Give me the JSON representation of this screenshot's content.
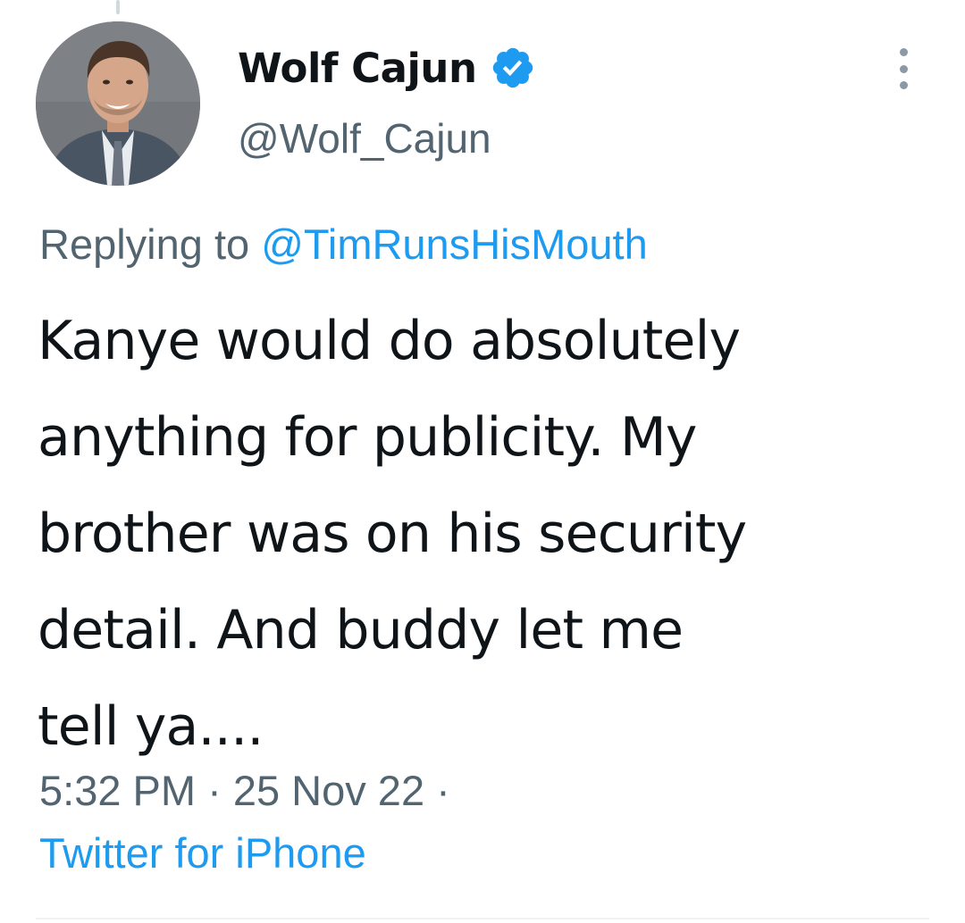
{
  "tweet": {
    "author": {
      "display_name": "Wolf Cajun",
      "handle": "@Wolf_Cajun",
      "verified": true,
      "verified_color": "#1d9bf0"
    },
    "reply": {
      "prefix": "Replying to",
      "mention": "@TimRunsHisMouth"
    },
    "text_lines": [
      "Kanye would do absolutely",
      "anything for publicity. My",
      "brother was on his security",
      "detail. And buddy let me",
      "tell ya...."
    ],
    "time": "5:32 PM",
    "date": "25 Nov 22",
    "separator": "·",
    "source": "Twitter for iPhone"
  },
  "colors": {
    "text_primary": "#0f1419",
    "text_secondary": "#536471",
    "link": "#1d9bf0"
  },
  "icons": {
    "verified": "verified-badge-icon",
    "more": "more-options-icon"
  }
}
